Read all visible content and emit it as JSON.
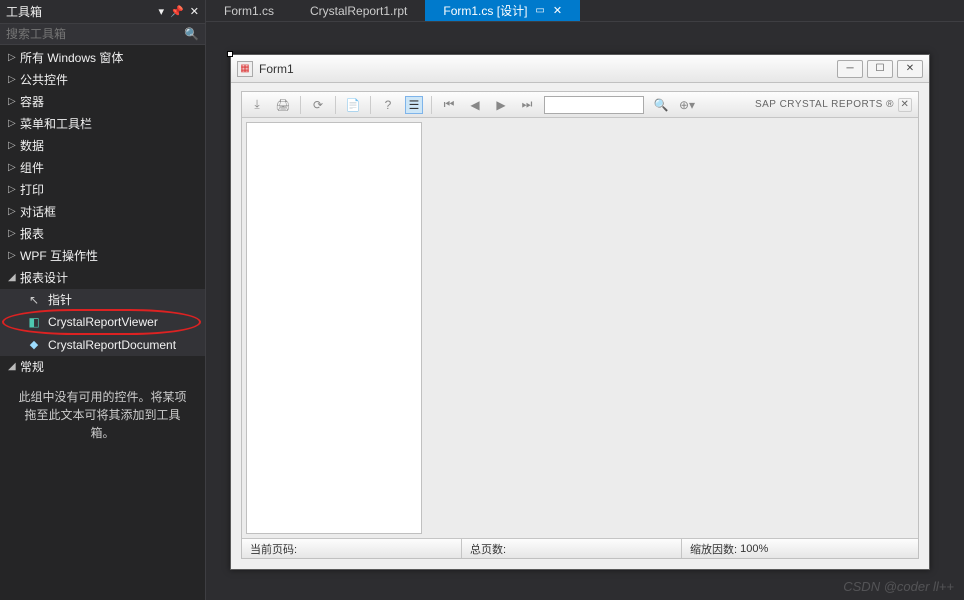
{
  "toolbox": {
    "title": "工具箱",
    "search_placeholder": "搜索工具箱",
    "groups": [
      {
        "label": "所有 Windows 窗体",
        "expanded": false
      },
      {
        "label": "公共控件",
        "expanded": false
      },
      {
        "label": "容器",
        "expanded": false
      },
      {
        "label": "菜单和工具栏",
        "expanded": false
      },
      {
        "label": "数据",
        "expanded": false
      },
      {
        "label": "组件",
        "expanded": false
      },
      {
        "label": "打印",
        "expanded": false
      },
      {
        "label": "对话框",
        "expanded": false
      },
      {
        "label": "报表",
        "expanded": false
      },
      {
        "label": "WPF 互操作性",
        "expanded": false
      },
      {
        "label": "报表设计",
        "expanded": true,
        "items": [
          {
            "label": "指针",
            "icon": "pointer-icon"
          },
          {
            "label": "CrystalReportViewer",
            "icon": "crv-icon",
            "circled": true
          },
          {
            "label": "CrystalReportDocument",
            "icon": "crd-icon"
          }
        ]
      },
      {
        "label": "常规",
        "expanded": true,
        "empty_msg": "此组中没有可用的控件。将某项拖至此文本可将其添加到工具箱。"
      }
    ]
  },
  "tabs": [
    {
      "label": "Form1.cs",
      "active": false
    },
    {
      "label": "CrystalReport1.rpt",
      "active": false
    },
    {
      "label": "Form1.cs [设计]",
      "active": true
    }
  ],
  "form": {
    "title": "Form1"
  },
  "crv": {
    "brand": "SAP CRYSTAL REPORTS ®",
    "status": {
      "current_page_label": "当前页码:",
      "total_pages_label": "总页数:",
      "zoom_label": "缩放因数:",
      "zoom_value": "100%"
    }
  },
  "watermark": "CSDN @coder ll++"
}
